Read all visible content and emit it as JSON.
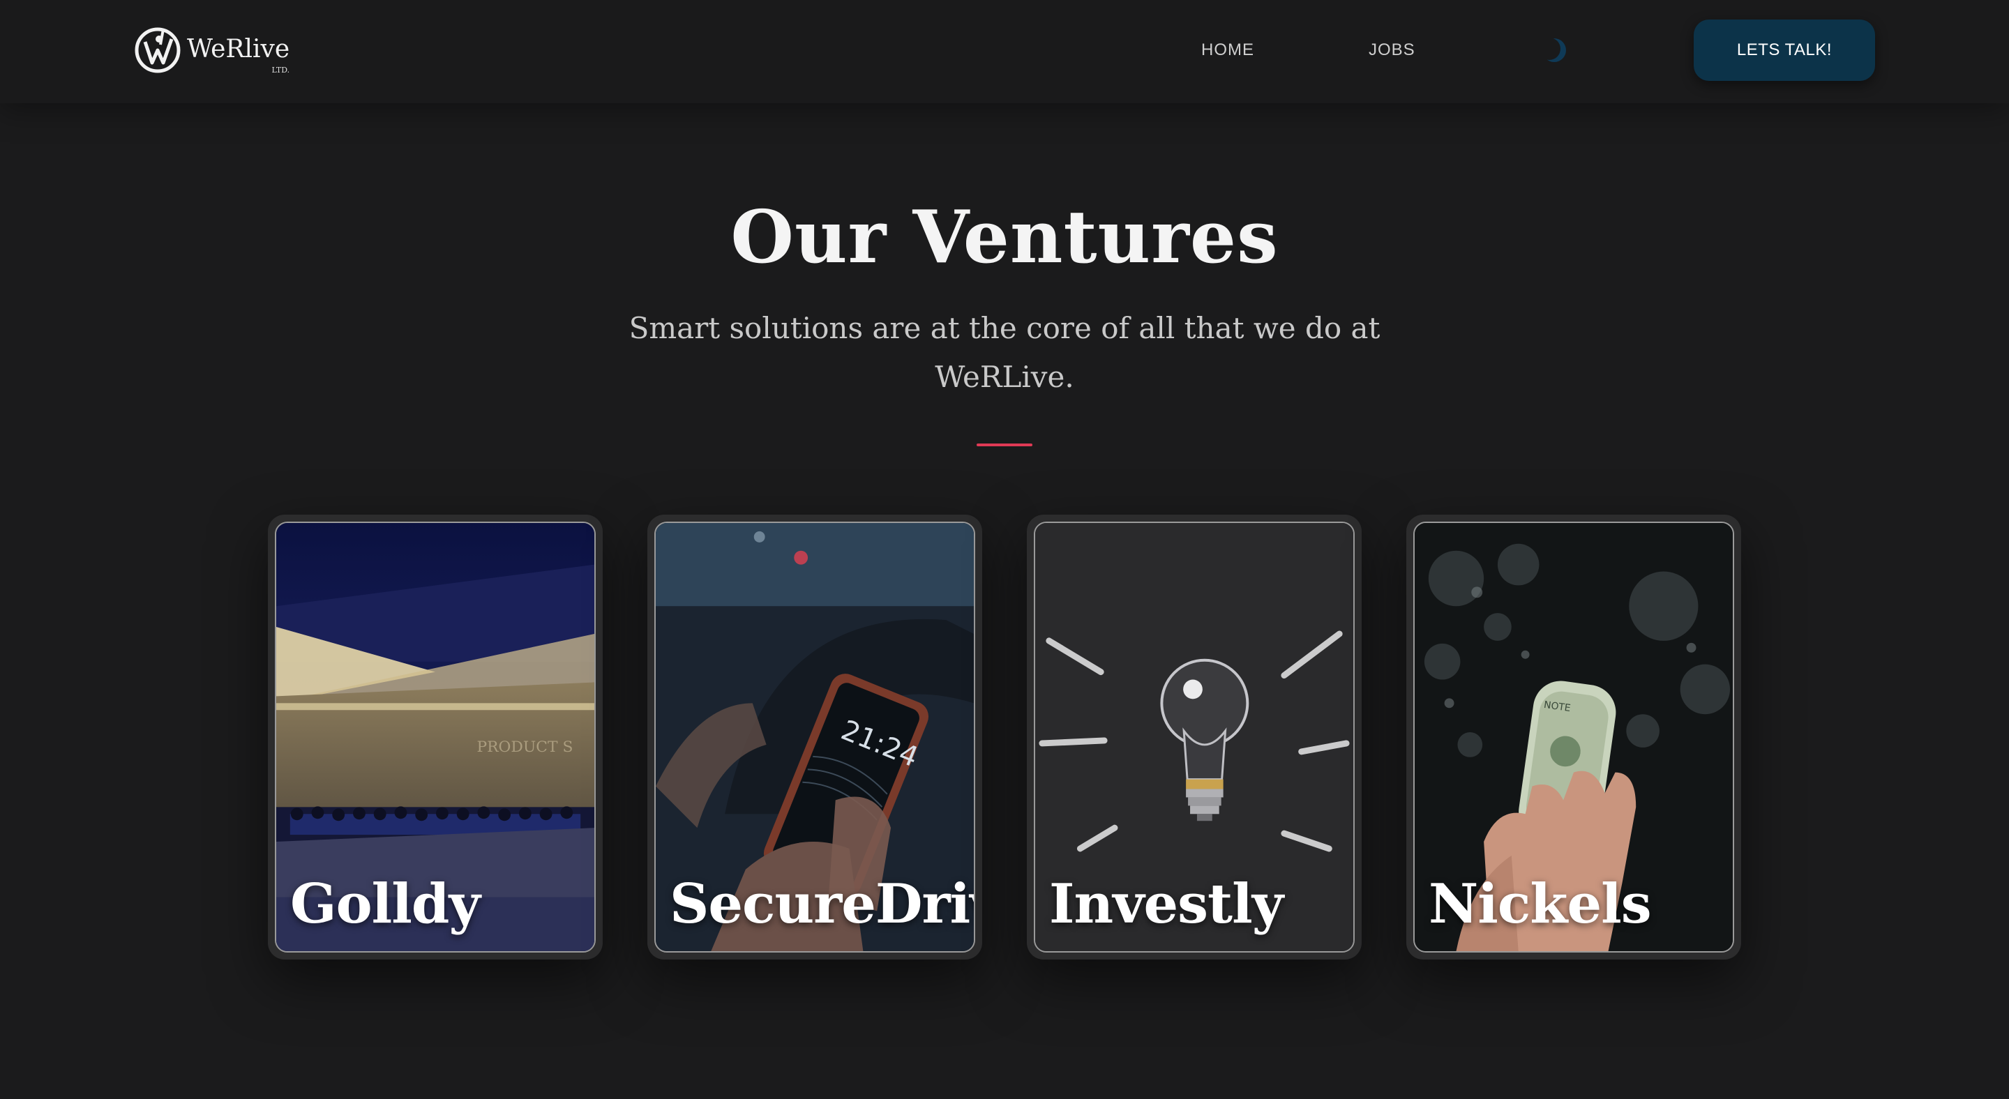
{
  "header": {
    "logo_name": "WeRlive",
    "logo_sub": "LTD.",
    "nav": [
      {
        "label": "HOME"
      },
      {
        "label": "JOBS"
      }
    ],
    "theme_toggle_icon": "moon-icon",
    "cta_label": "LETS TALK!"
  },
  "hero": {
    "title": "Our Ventures",
    "subtitle": "Smart solutions are at the core of all that we do at WeRLive.",
    "divider_color": "#e03a55"
  },
  "ventures": [
    {
      "name": "Golldy",
      "image": "conference-hall-photo"
    },
    {
      "name": "SecureDrive",
      "image": "phone-in-car-photo"
    },
    {
      "name": "Investly",
      "image": "lightbulb-chalkboard-photo"
    },
    {
      "name": "Nickels",
      "image": "hand-holding-cash-photo"
    }
  ],
  "colors": {
    "background": "#1b1b1c",
    "cta_background": "#0c3349",
    "accent": "#e03a55"
  }
}
